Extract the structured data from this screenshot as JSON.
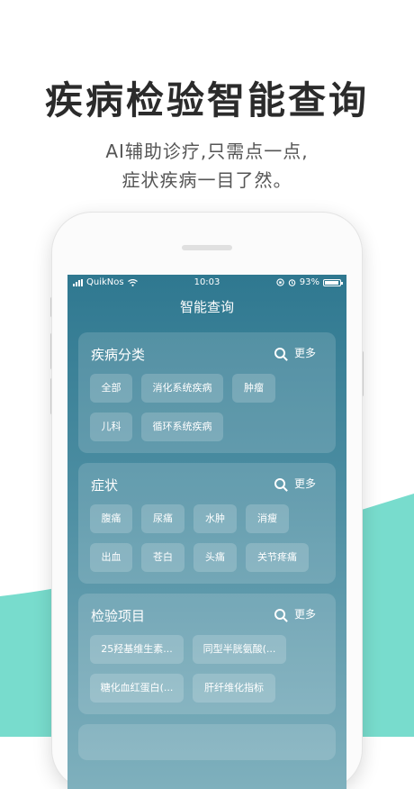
{
  "promo": {
    "headline": "疾病检验智能查询",
    "tagline_line1": "AI辅助诊疗,只需点一点,",
    "tagline_line2": "症状疾病一目了然。",
    "accent_color": "#78dccd"
  },
  "status_bar": {
    "carrier": "QuikNos",
    "time": "10:03",
    "battery": "93%",
    "battery_level": 0.93
  },
  "app": {
    "title": "智能查询"
  },
  "sections": {
    "disease": {
      "title": "疾病分类",
      "more": "更多",
      "chips": [
        "全部",
        "消化系统疾病",
        "肿瘤",
        "儿科",
        "循环系统疾病"
      ]
    },
    "symptom": {
      "title": "症状",
      "more": "更多",
      "chips": [
        "腹痛",
        "尿痛",
        "水肿",
        "消瘦",
        "出血",
        "苍白",
        "头痛",
        "关节疼痛"
      ]
    },
    "test": {
      "title": "检验项目",
      "more": "更多",
      "chips": [
        "25羟基维生素...",
        "同型半胱氨酸(...",
        "糖化血红蛋白(...",
        "肝纤维化指标"
      ]
    }
  }
}
